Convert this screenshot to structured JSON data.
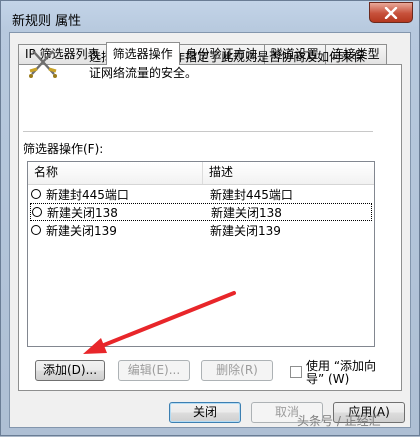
{
  "window": {
    "title": "新规则 属性"
  },
  "tabs": [
    {
      "label": "IP 筛选器列表"
    },
    {
      "label": "筛选器操作"
    },
    {
      "label": "身份验证方法"
    },
    {
      "label": "隧道设置"
    },
    {
      "label": "连接类型"
    }
  ],
  "active_tab": "筛选器操作",
  "description": "选择的筛选器操作指定了此规则是否协商及如何来保证网络流量的安全。",
  "list": {
    "label": "筛选器操作(F):",
    "columns": [
      "名称",
      "描述"
    ],
    "rows": [
      {
        "name": "新建封445端口",
        "desc": "新建封445端口"
      },
      {
        "name": "新建关闭138",
        "desc": "新建关闭138"
      },
      {
        "name": "新建关闭139",
        "desc": "新建关闭139"
      }
    ]
  },
  "buttons": {
    "add": "添加(D)...",
    "edit": "编辑(E)...",
    "delete": "删除(R)",
    "close": "关闭",
    "cancel": "取消",
    "apply": "应用(A)"
  },
  "checkbox": {
    "label": "使用 “添加向导” (W)",
    "checked": false
  },
  "annotation": {
    "arrow_color": "#e8262a"
  },
  "watermark": "头条号 / 正经汇"
}
